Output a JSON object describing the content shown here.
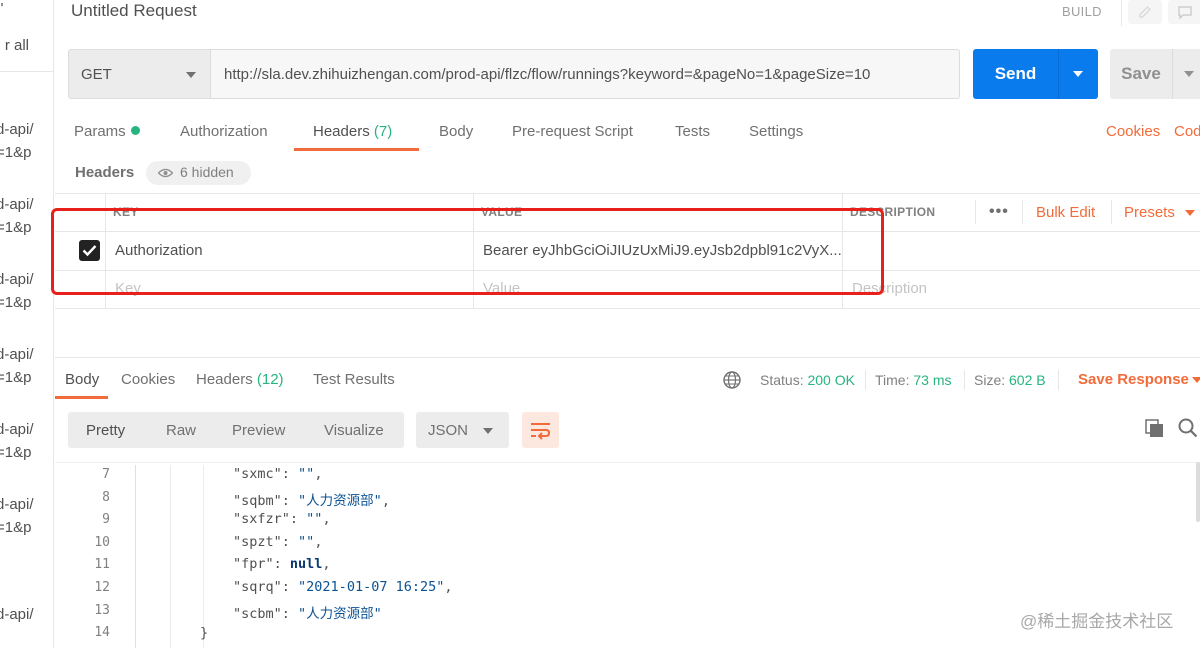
{
  "sidebar": {
    "clear_label": "r all",
    "top_mark": "\"",
    "items": [
      {
        "line1": "d-api/",
        "line2": "=1&p"
      },
      {
        "line1": "d-api/",
        "line2": "=1&p"
      },
      {
        "line1": "d-api/",
        "line2": "=1&p"
      },
      {
        "line1": "d-api/",
        "line2": "=1&p"
      },
      {
        "line1": "d-api/",
        "line2": "=1&p"
      },
      {
        "line1": "d-api/",
        "line2": "=1&p"
      },
      {
        "line1": "d-api/",
        "line2": ""
      }
    ]
  },
  "header": {
    "title": "Untitled Request",
    "build_label": "BUILD"
  },
  "request": {
    "method": "GET",
    "url": "http://sla.dev.zhihuizhengan.com/prod-api/flzc/flow/runnings?keyword=&pageNo=1&pageSize=10",
    "send_label": "Send",
    "save_label": "Save"
  },
  "request_tabs": {
    "params": "Params",
    "authorization": "Authorization",
    "headers": "Headers",
    "headers_count": "(7)",
    "body": "Body",
    "prerequest": "Pre-request Script",
    "tests": "Tests",
    "settings": "Settings",
    "cookies_link": "Cookies",
    "code_link": "Cod"
  },
  "headers_section": {
    "label": "Headers",
    "hidden_label": "6 hidden",
    "columns": {
      "key": "KEY",
      "value": "VALUE",
      "description": "DESCRIPTION"
    },
    "bulk_edit": "Bulk Edit",
    "presets": "Presets",
    "more": "•••",
    "rows": [
      {
        "checked": true,
        "key": "Authorization",
        "value": "Bearer eyJhbGciOiJIUzUxMiJ9.eyJsb2dpbl91c2VyX...",
        "description": ""
      }
    ],
    "placeholders": {
      "key": "Key",
      "value": "Value",
      "description": "Description"
    }
  },
  "response": {
    "tabs": {
      "body": "Body",
      "cookies": "Cookies",
      "headers": "Headers",
      "headers_count": "(12)",
      "test_results": "Test Results"
    },
    "status_label": "Status:",
    "status_value": "200 OK",
    "time_label": "Time:",
    "time_value": "73 ms",
    "size_label": "Size:",
    "size_value": "602 B",
    "save_response": "Save Response",
    "views": {
      "pretty": "Pretty",
      "raw": "Raw",
      "preview": "Preview",
      "visualize": "Visualize"
    },
    "format": "JSON"
  },
  "code": {
    "lines": [
      {
        "num": "7",
        "key": "\"sxmc\"",
        "value": "\"\"",
        "type": "string",
        "trail": ","
      },
      {
        "num": "8",
        "key": "\"sqbm\"",
        "value": "\"人力资源部\"",
        "type": "string",
        "trail": ","
      },
      {
        "num": "9",
        "key": "\"sxfzr\"",
        "value": "\"\"",
        "type": "string",
        "trail": ","
      },
      {
        "num": "10",
        "key": "\"spzt\"",
        "value": "\"\"",
        "type": "string",
        "trail": ","
      },
      {
        "num": "11",
        "key": "\"fpr\"",
        "value": "null",
        "type": "null",
        "trail": ","
      },
      {
        "num": "12",
        "key": "\"sqrq\"",
        "value": "\"2021-01-07 16:25\"",
        "type": "string",
        "trail": ","
      },
      {
        "num": "13",
        "key": "\"scbm\"",
        "value": "\"人力资源部\"",
        "type": "string",
        "trail": ""
      },
      {
        "num": "14",
        "key": "",
        "value": "",
        "type": "brace",
        "trail": ""
      }
    ],
    "closing_brace": "}"
  },
  "watermark": "@稀土掘金技术社区",
  "colors": {
    "accent": "#f26b3a",
    "send_blue": "#097bed",
    "success_green": "#26b47f",
    "highlight_red": "#e8201a"
  }
}
